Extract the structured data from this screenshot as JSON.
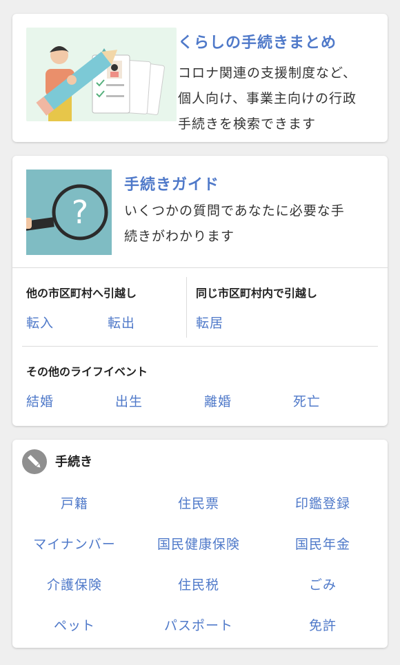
{
  "summary": {
    "title": "くらしの手続きまとめ",
    "desc_lines": [
      "コロナ関連の支援制度など、",
      "個人向け、事業主向けの行政",
      "手続きを検索できます"
    ]
  },
  "guide": {
    "title": "手続きガイド",
    "desc_lines": [
      "いくつかの質問であなたに必要な手",
      "続きがわかります"
    ],
    "move_out": {
      "label": "他の市区町村へ引越し",
      "links": [
        "転入",
        "転出"
      ]
    },
    "move_within": {
      "label": "同じ市区町村内で引越し",
      "links": [
        "転居"
      ]
    },
    "life_events": {
      "label": "その他のライフイベント",
      "links": [
        "結婚",
        "出生",
        "離婚",
        "死亡"
      ]
    }
  },
  "procedures": {
    "title": "手続き",
    "items": [
      [
        "戸籍",
        "住民票",
        "印鑑登録"
      ],
      [
        "マイナンバー",
        "国民健康保険",
        "国民年金"
      ],
      [
        "介護保険",
        "住民税",
        "ごみ"
      ],
      [
        "ペット",
        "パスポート",
        "免許"
      ]
    ]
  },
  "colors": {
    "link": "#4f79c9",
    "guide_thumb": "#7fbcc3",
    "summary_thumb": "#e8f6ec"
  },
  "icons": {
    "summary_thumb": "person-with-pencil-illustration",
    "guide_thumb": "magnifier-question-illustration",
    "procedures": "pencil-icon"
  }
}
